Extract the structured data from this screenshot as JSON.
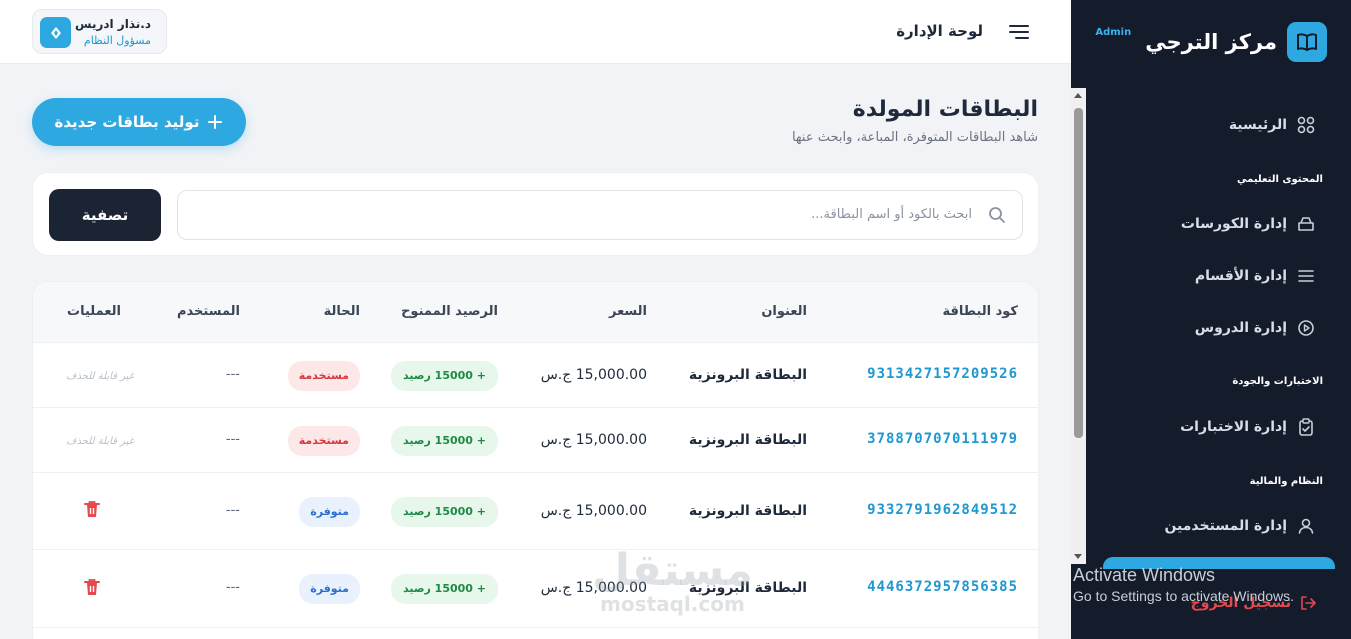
{
  "sidebar": {
    "brand_title": "مركز الترجي",
    "brand_badge": "Admin",
    "items": [
      {
        "label": "الرئيسية"
      },
      {
        "label": "إدارة الكورسات"
      },
      {
        "label": "إدارة الأقسام"
      },
      {
        "label": "إدارة الدروس"
      },
      {
        "label": "إدارة الاختبارات"
      },
      {
        "label": "إدارة المستخدمين"
      }
    ],
    "sections": [
      "المحتوى التعليمي",
      "الاختبارات والجودة",
      "النظام والمالية"
    ],
    "logout_label": "تسجيل الخروج"
  },
  "os_overlay": {
    "line1": "Activate Windows",
    "line2": "Go to Settings to activate Windows."
  },
  "topbar": {
    "title": "لوحة الإدارة",
    "user_name": "د.نذار ادريس",
    "user_role": "مسؤول النظام"
  },
  "header": {
    "title": "البطاقات المولدة",
    "subtitle": "شاهد البطاقات المتوفرة، المباعة، وابحث عنها",
    "generate_button": "توليد بطاقات جديدة"
  },
  "search": {
    "placeholder": "ابحث بالكود أو اسم البطاقة...",
    "filter_button": "تصفية"
  },
  "table": {
    "columns": [
      "كود البطاقة",
      "العنوان",
      "السعر",
      "الرصيد الممنوح",
      "الحالة",
      "المستخدم",
      "العمليات"
    ],
    "rows": [
      {
        "code": "931342715720952​6",
        "title": "البطاقة البرونزية",
        "price": "15,000.00 ج.س",
        "balance": "+ 15000 رصيد",
        "status": "مستخدمة",
        "user": "---",
        "action": "غير قابلة للحذف"
      },
      {
        "code": "3788707070111979",
        "title": "البطاقة البرونزية",
        "price": "15,000.00 ج.س",
        "balance": "+ 15000 رصيد",
        "status": "مستخدمة",
        "user": "---",
        "action": "غير قابلة للحذف"
      },
      {
        "code": "9332791962849512",
        "title": "البطاقة البرونزية",
        "price": "15,000.00 ج.س",
        "balance": "+ 15000 رصيد",
        "status": "متوفرة",
        "user": "---",
        "action": "delete-icon"
      },
      {
        "code": "4446372957856385",
        "title": "البطاقة البرونزية",
        "price": "15,000.00 ج.س",
        "balance": "+ 15000 رصيد",
        "status": "متوفرة",
        "user": "---",
        "action": "delete-icon"
      }
    ]
  },
  "watermark": {
    "line1": "مستقل",
    "line2": "mostaql.com"
  },
  "colors": {
    "accent": "#2ea8e0",
    "sidebar_bg": "#141b2b",
    "danger": "#e5484d",
    "success": "#1e8a45"
  }
}
